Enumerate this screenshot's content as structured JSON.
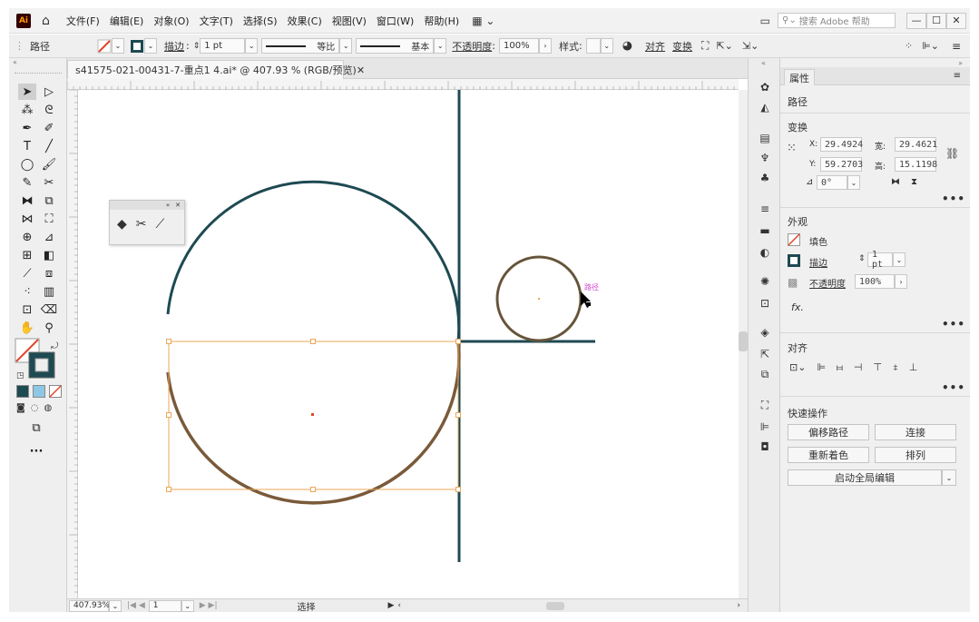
{
  "app": {
    "logo": "Ai",
    "menus": [
      "文件(F)",
      "编辑(E)",
      "对象(O)",
      "文字(T)",
      "选择(S)",
      "效果(C)",
      "视图(V)",
      "窗口(W)",
      "帮助(H)"
    ],
    "search_placeholder": "搜索 Adobe 帮助"
  },
  "control_bar": {
    "selection_type": "路径",
    "stroke_label": "描边",
    "stroke_value": "1 pt",
    "profile_label": "等比",
    "brush_label": "基本",
    "opacity_label": "不透明度",
    "opacity_value": "100%",
    "style_label": "样式",
    "align_label": "对齐",
    "transform_label": "变换"
  },
  "document": {
    "tab_title": "s41575-021-00431-7-重点1 4.ai* @ 407.93 % (RGB/预览)",
    "zoom": "407.93%",
    "artboard": "1",
    "status": "选择",
    "path_tooltip": "路径"
  },
  "properties": {
    "tab": "属性",
    "object_type": "路径",
    "transform_title": "变换",
    "x_label": "X:",
    "x_value": "29.4924",
    "y_label": "Y:",
    "y_value": "59.2703",
    "w_label": "宽:",
    "w_value": "29.4621",
    "h_label": "高:",
    "h_value": "15.1198",
    "angle_value": "0°",
    "appearance_title": "外观",
    "fill_label": "填色",
    "stroke_label": "描边",
    "stroke_value": "1 pt",
    "opacity_label": "不透明度",
    "opacity_value": "100%",
    "fx_label": "fx.",
    "align_title": "对齐",
    "quick_title": "快速操作",
    "btn_offset_path": "偏移路径",
    "btn_join": "连接",
    "btn_recolor": "重新着色",
    "btn_arrange": "排列",
    "btn_global_edit": "启动全局编辑"
  },
  "colors": {
    "stroke_dark": "#1e4a52",
    "selection_orange": "#e8a75a",
    "path_brown": "#7a5a3a",
    "accent_red": "#e0452b"
  }
}
